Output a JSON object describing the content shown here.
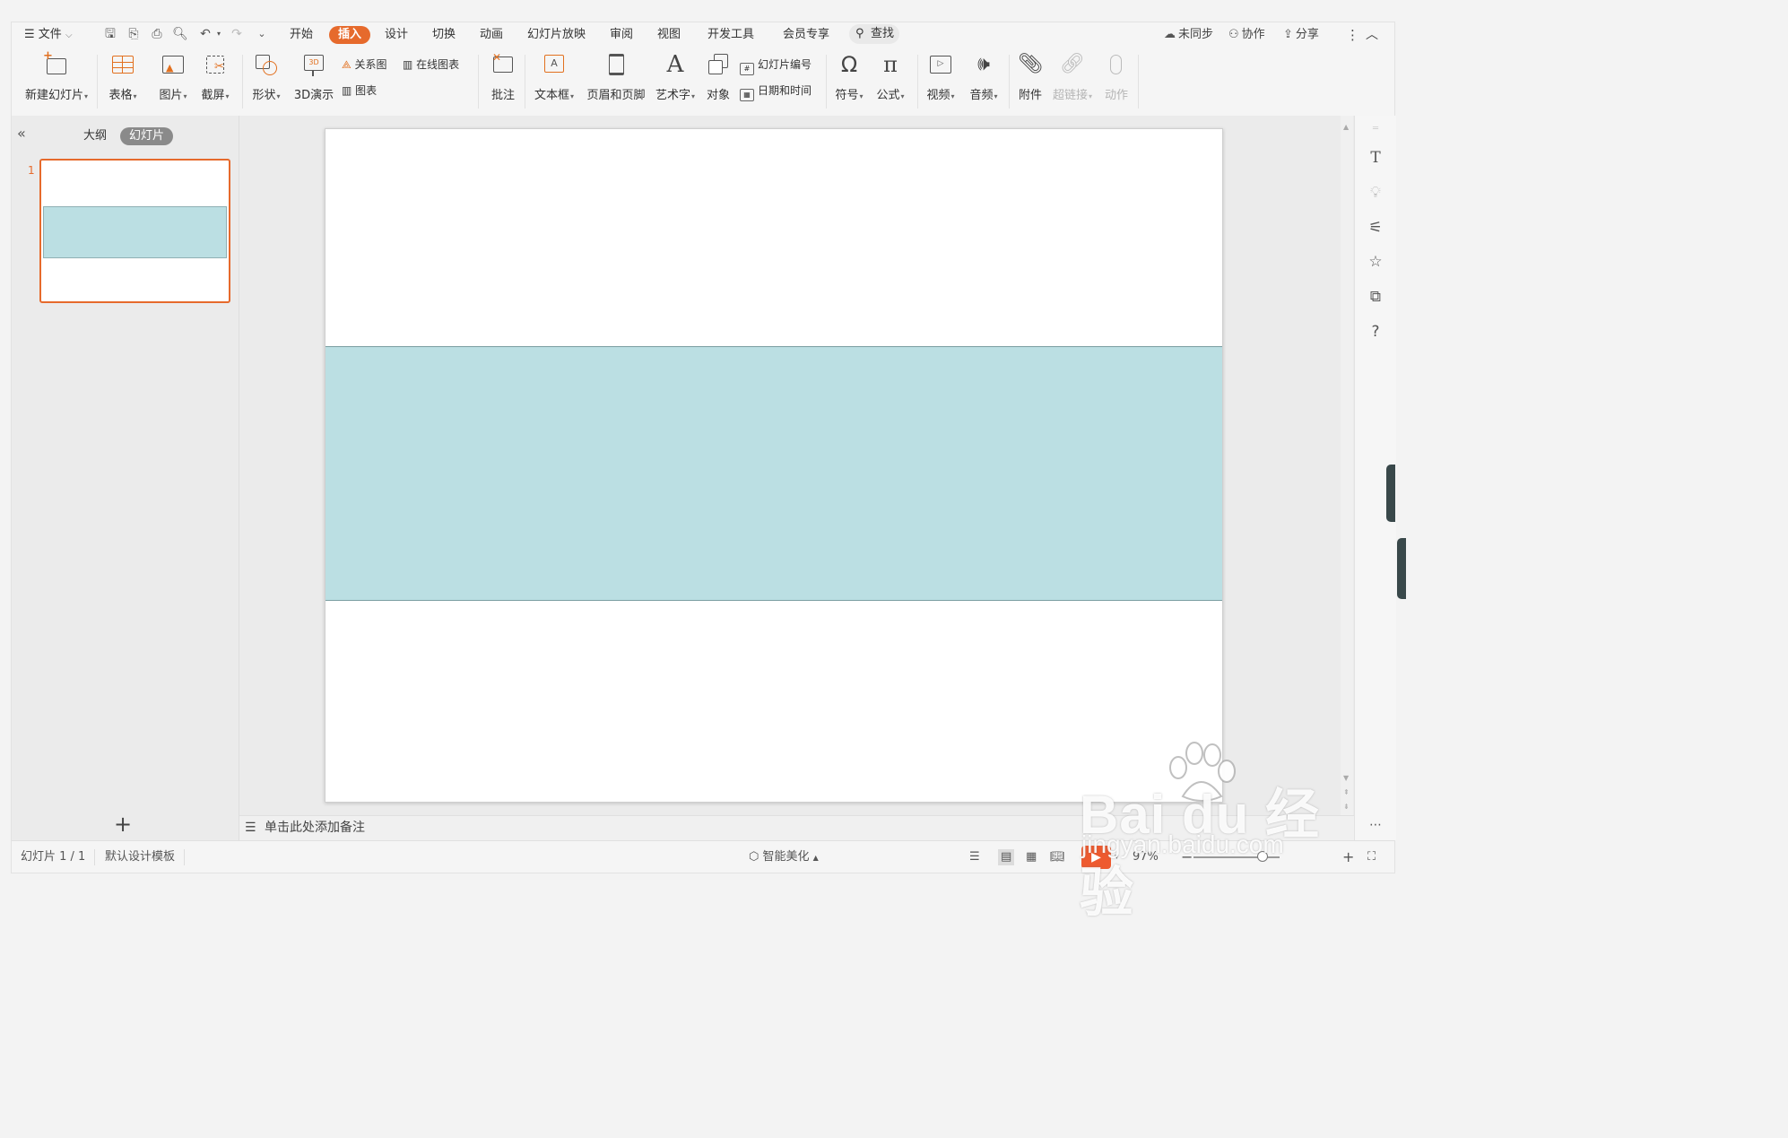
{
  "menu": {
    "hamburger_label": "文件",
    "tabs": [
      {
        "label": "开始"
      },
      {
        "label": "插入",
        "active": true
      },
      {
        "label": "设计"
      },
      {
        "label": "切换"
      },
      {
        "label": "动画"
      },
      {
        "label": "幻灯片放映"
      },
      {
        "label": "审阅"
      },
      {
        "label": "视图"
      },
      {
        "label": "开发工具"
      },
      {
        "label": "会员专享"
      }
    ],
    "search_label": "查找",
    "sync_label": "未同步",
    "collab_label": "协作",
    "share_label": "分享"
  },
  "ribbon": {
    "new_slide": "新建幻灯片",
    "table": "表格",
    "picture": "图片",
    "screenshot": "截屏",
    "shape": "形状",
    "3d": "3D演示",
    "smartart": "关系图",
    "online_chart": "在线图表",
    "chart": "图表",
    "comment": "批注",
    "textbox": "文本框",
    "header_footer": "页眉和页脚",
    "wordart": "艺术字",
    "object": "对象",
    "slide_number": "幻灯片编号",
    "datetime": "日期和时间",
    "symbol": "符号",
    "formula": "公式",
    "video": "视频",
    "audio": "音频",
    "attachment": "附件",
    "hyperlink": "超链接",
    "action": "动作"
  },
  "left_panel": {
    "tab_outline": "大纲",
    "tab_slides": "幻灯片",
    "slide_number": "1"
  },
  "slide": {
    "band_color": "#bbdfe3",
    "accent_color": "#e66a2c"
  },
  "notes_placeholder": "单击此处添加备注",
  "status": {
    "slide_info": "幻灯片 1 / 1",
    "template": "默认设计模板",
    "smart_beautify": "智能美化",
    "zoom": "97%"
  },
  "watermark": {
    "brand": "Bai du 经验",
    "url": "jingyan.baidu.com"
  }
}
